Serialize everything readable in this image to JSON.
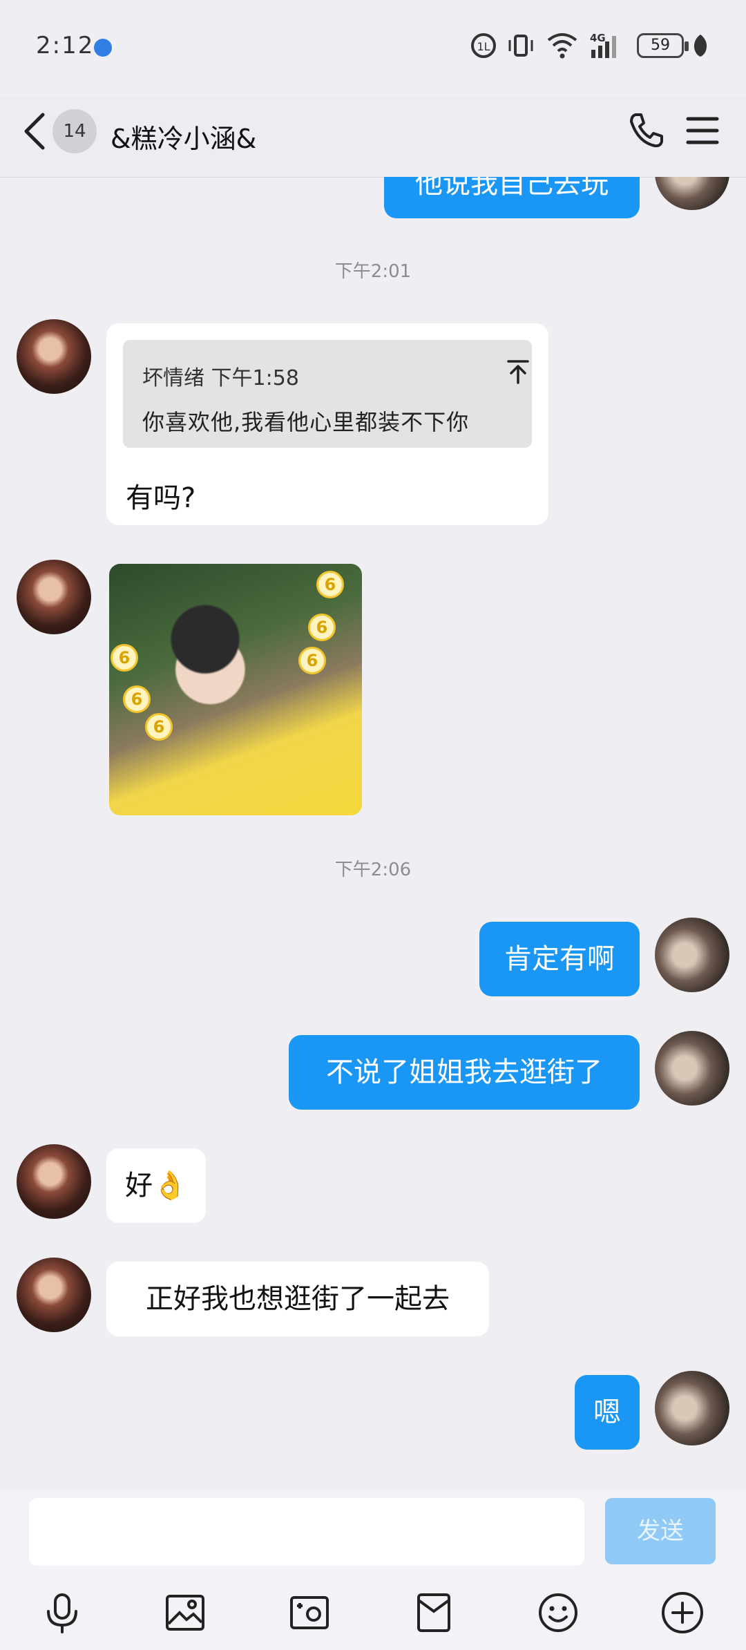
{
  "status_bar": {
    "time": "2:12",
    "battery": "59"
  },
  "header": {
    "unread_count": "14",
    "contact_name": "&糕冷小涵&"
  },
  "messages": {
    "top_partial": "他说我自己去玩",
    "ts1": "下午2:01",
    "quote_meta": "坏情绪 下午1:58",
    "quote_text": "你喜欢他,我看他心里都装不下你",
    "reply_text": "有吗?",
    "sticker_label": "6",
    "ts2": "下午2:06",
    "out1": "肯定有啊",
    "out2": "不说了姐姐我去逛街了",
    "in1": "好👌",
    "in2": "正好我也想逛街了一起去",
    "out3": "嗯"
  },
  "input": {
    "value": "",
    "send_label": "发送"
  },
  "toolbar": {
    "icons": [
      "microphone-icon",
      "image-icon",
      "camera-icon",
      "red-packet-icon",
      "emoji-icon",
      "plus-icon"
    ]
  },
  "colors": {
    "outgoing_bubble": "#1a96f4",
    "send_disabled": "#8fcaf6",
    "background": "#eeeef3"
  }
}
